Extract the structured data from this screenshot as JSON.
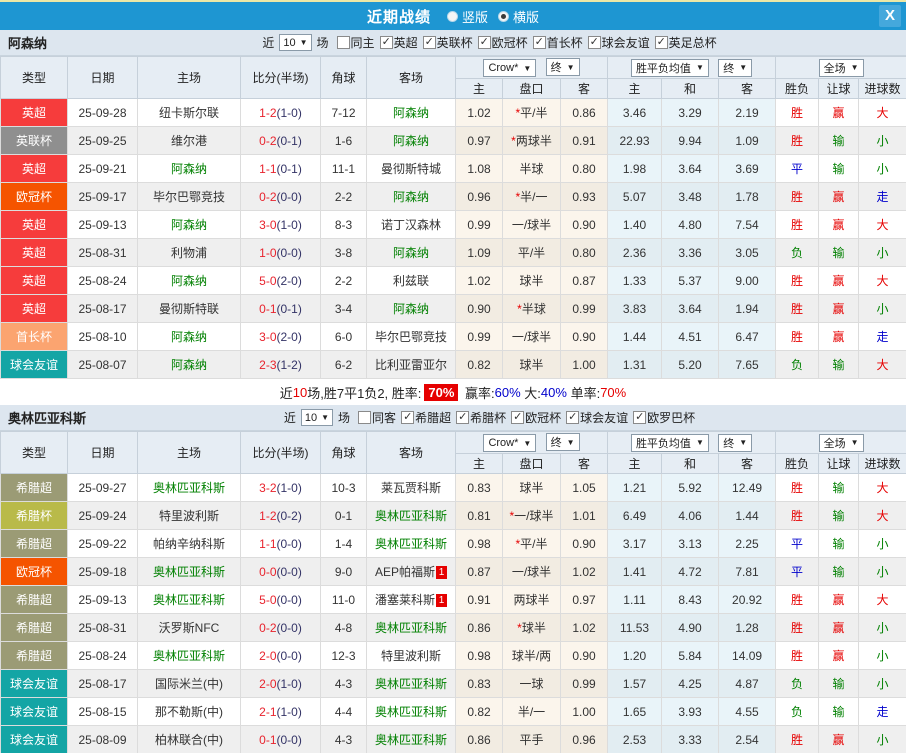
{
  "titlebar": {
    "title": "近期战绩",
    "vertical_label": "竖版",
    "horizontal_label": "横版",
    "selected_layout": "横版",
    "close_label": "X",
    "bar_color": "#1e96d2"
  },
  "table_header": {
    "type": "类型",
    "date": "日期",
    "home": "主场",
    "score": "比分(半场)",
    "corner": "角球",
    "away": "客场",
    "crow_select": "Crow*",
    "final_select": "终",
    "wdl_select": "胜平负均值",
    "final_select2": "终",
    "full_select": "全场",
    "sub_home": "主",
    "sub_handicap": "盘口",
    "sub_away": "客",
    "sub_whome": "主",
    "sub_draw": "和",
    "sub_waway": "客",
    "sub_result": "胜负",
    "sub_handicap_result": "让球",
    "sub_goals": "进球数"
  },
  "type_colors": {
    "英超": "#f63c3c",
    "英联杯": "#8f8f8f",
    "欧冠杯": "#f55400",
    "首长杯": "#fba470",
    "球会友谊": "#14a5a5",
    "希腊超": "#9b9b75",
    "希腊杯": "#b9ba49"
  },
  "value_colors": {
    "win": "#e60000",
    "draw": "#0000cc",
    "lose": "#008000",
    "self_team": "#008000",
    "score": "#e8232d",
    "half_score": "#333366"
  },
  "sections": [
    {
      "team": "阿森纳",
      "filters": {
        "near_label": "近",
        "count": "10",
        "unit_label": "场",
        "same_label": "同主",
        "same_checked": false,
        "leagues": [
          "英超",
          "英联杯",
          "欧冠杯",
          "首长杯",
          "球会友谊",
          "英足总杯"
        ]
      },
      "rows": [
        {
          "type": "英超",
          "date": "25-09-28",
          "home": "纽卡斯尔联",
          "score": "1-2",
          "half": "(1-0)",
          "corner": "7-12",
          "away": "阿森纳",
          "crow_home": "1.02",
          "handicap": "*平/半",
          "crow_away": "0.86",
          "odds_home": "3.46",
          "odds_draw": "3.29",
          "odds_away": "2.19",
          "result": "胜",
          "handicap_result": "赢",
          "goals": "大"
        },
        {
          "type": "英联杯",
          "date": "25-09-25",
          "home": "维尔港",
          "score": "0-2",
          "half": "(0-1)",
          "corner": "1-6",
          "away": "阿森纳",
          "crow_home": "0.97",
          "handicap": "*两球半",
          "crow_away": "0.91",
          "odds_home": "22.93",
          "odds_draw": "9.94",
          "odds_away": "1.09",
          "result": "胜",
          "handicap_result": "输",
          "goals": "小"
        },
        {
          "type": "英超",
          "date": "25-09-21",
          "home": "阿森纳",
          "score": "1-1",
          "half": "(0-1)",
          "corner": "11-1",
          "away": "曼彻斯特城",
          "crow_home": "1.08",
          "handicap": "半球",
          "crow_away": "0.80",
          "odds_home": "1.98",
          "odds_draw": "3.64",
          "odds_away": "3.69",
          "result": "平",
          "handicap_result": "输",
          "goals": "小"
        },
        {
          "type": "欧冠杯",
          "date": "25-09-17",
          "home": "毕尔巴鄂竞技",
          "score": "0-2",
          "half": "(0-0)",
          "corner": "2-2",
          "away": "阿森纳",
          "crow_home": "0.96",
          "handicap": "*半/一",
          "crow_away": "0.93",
          "odds_home": "5.07",
          "odds_draw": "3.48",
          "odds_away": "1.78",
          "result": "胜",
          "handicap_result": "赢",
          "goals": "走"
        },
        {
          "type": "英超",
          "date": "25-09-13",
          "home": "阿森纳",
          "score": "3-0",
          "half": "(1-0)",
          "corner": "8-3",
          "away": "诺丁汉森林",
          "crow_home": "0.99",
          "handicap": "一/球半",
          "crow_away": "0.90",
          "odds_home": "1.40",
          "odds_draw": "4.80",
          "odds_away": "7.54",
          "result": "胜",
          "handicap_result": "赢",
          "goals": "大"
        },
        {
          "type": "英超",
          "date": "25-08-31",
          "home": "利物浦",
          "score": "1-0",
          "half": "(0-0)",
          "corner": "3-8",
          "away": "阿森纳",
          "crow_home": "1.09",
          "handicap": "平/半",
          "crow_away": "0.80",
          "odds_home": "2.36",
          "odds_draw": "3.36",
          "odds_away": "3.05",
          "result": "负",
          "handicap_result": "输",
          "goals": "小"
        },
        {
          "type": "英超",
          "date": "25-08-24",
          "home": "阿森纳",
          "score": "5-0",
          "half": "(2-0)",
          "corner": "2-2",
          "away": "利兹联",
          "crow_home": "1.02",
          "handicap": "球半",
          "crow_away": "0.87",
          "odds_home": "1.33",
          "odds_draw": "5.37",
          "odds_away": "9.00",
          "result": "胜",
          "handicap_result": "赢",
          "goals": "大"
        },
        {
          "type": "英超",
          "date": "25-08-17",
          "home": "曼彻斯特联",
          "score": "0-1",
          "half": "(0-1)",
          "corner": "3-4",
          "away": "阿森纳",
          "crow_home": "0.90",
          "handicap": "*半球",
          "crow_away": "0.99",
          "odds_home": "3.83",
          "odds_draw": "3.64",
          "odds_away": "1.94",
          "result": "胜",
          "handicap_result": "赢",
          "goals": "小"
        },
        {
          "type": "首长杯",
          "date": "25-08-10",
          "home": "阿森纳",
          "score": "3-0",
          "half": "(2-0)",
          "corner": "6-0",
          "away": "毕尔巴鄂竞技",
          "crow_home": "0.99",
          "handicap": "一/球半",
          "crow_away": "0.90",
          "odds_home": "1.44",
          "odds_draw": "4.51",
          "odds_away": "6.47",
          "result": "胜",
          "handicap_result": "赢",
          "goals": "走"
        },
        {
          "type": "球会友谊",
          "date": "25-08-07",
          "home": "阿森纳",
          "score": "2-3",
          "half": "(1-2)",
          "corner": "6-2",
          "away": "比利亚雷亚尔",
          "crow_home": "0.82",
          "handicap": "球半",
          "crow_away": "1.00",
          "odds_home": "1.31",
          "odds_draw": "5.20",
          "odds_away": "7.65",
          "result": "负",
          "handicap_result": "输",
          "goals": "大"
        }
      ],
      "summary": {
        "parts": [
          {
            "text": "近",
            "color": "black"
          },
          {
            "text": "10",
            "color": "red"
          },
          {
            "text": "场,胜7平1负2, 胜率:",
            "color": "black"
          },
          {
            "text": "70%",
            "color": "white-on-red"
          },
          {
            "text": " 赢率:",
            "color": "black"
          },
          {
            "text": "60%",
            "color": "blue"
          },
          {
            "text": " 大:",
            "color": "black"
          },
          {
            "text": "40%",
            "color": "blue"
          },
          {
            "text": " 单率:",
            "color": "black"
          },
          {
            "text": "70%",
            "color": "red"
          }
        ]
      }
    },
    {
      "team": "奥林匹亚科斯",
      "filters": {
        "near_label": "近",
        "count": "10",
        "unit_label": "场",
        "same_label": "同客",
        "same_checked": false,
        "leagues": [
          "希腊超",
          "希腊杯",
          "欧冠杯",
          "球会友谊",
          "欧罗巴杯"
        ]
      },
      "rows": [
        {
          "type": "希腊超",
          "date": "25-09-27",
          "home": "奥林匹亚科斯",
          "score": "3-2",
          "half": "(1-0)",
          "corner": "10-3",
          "away": "莱瓦贾科斯",
          "crow_home": "0.83",
          "handicap": "球半",
          "crow_away": "1.05",
          "odds_home": "1.21",
          "odds_draw": "5.92",
          "odds_away": "12.49",
          "result": "胜",
          "handicap_result": "输",
          "goals": "大"
        },
        {
          "type": "希腊杯",
          "date": "25-09-24",
          "home": "特里波利斯",
          "score": "1-2",
          "half": "(0-2)",
          "corner": "0-1",
          "away": "奥林匹亚科斯",
          "crow_home": "0.81",
          "handicap": "*一/球半",
          "crow_away": "1.01",
          "odds_home": "6.49",
          "odds_draw": "4.06",
          "odds_away": "1.44",
          "result": "胜",
          "handicap_result": "输",
          "goals": "大"
        },
        {
          "type": "希腊超",
          "date": "25-09-22",
          "home": "帕纳辛纳科斯",
          "score": "1-1",
          "half": "(0-0)",
          "corner": "1-4",
          "away": "奥林匹亚科斯",
          "crow_home": "0.98",
          "handicap": "*平/半",
          "crow_away": "0.90",
          "odds_home": "3.17",
          "odds_draw": "3.13",
          "odds_away": "2.25",
          "result": "平",
          "handicap_result": "输",
          "goals": "小"
        },
        {
          "type": "欧冠杯",
          "date": "25-09-18",
          "home": "奥林匹亚科斯",
          "score": "0-0",
          "half": "(0-0)",
          "corner": "9-0",
          "away": "AEP帕福斯",
          "away_red": "1",
          "crow_home": "0.87",
          "handicap": "一/球半",
          "crow_away": "1.02",
          "odds_home": "1.41",
          "odds_draw": "4.72",
          "odds_away": "7.81",
          "result": "平",
          "handicap_result": "输",
          "goals": "小"
        },
        {
          "type": "希腊超",
          "date": "25-09-13",
          "home": "奥林匹亚科斯",
          "score": "5-0",
          "half": "(0-0)",
          "corner": "11-0",
          "away": "潘塞莱科斯",
          "away_red": "1",
          "crow_home": "0.91",
          "handicap": "两球半",
          "crow_away": "0.97",
          "odds_home": "1.11",
          "odds_draw": "8.43",
          "odds_away": "20.92",
          "result": "胜",
          "handicap_result": "赢",
          "goals": "大"
        },
        {
          "type": "希腊超",
          "date": "25-08-31",
          "home": "沃罗斯NFC",
          "score": "0-2",
          "half": "(0-0)",
          "corner": "4-8",
          "away": "奥林匹亚科斯",
          "crow_home": "0.86",
          "handicap": "*球半",
          "crow_away": "1.02",
          "odds_home": "11.53",
          "odds_draw": "4.90",
          "odds_away": "1.28",
          "result": "胜",
          "handicap_result": "赢",
          "goals": "小"
        },
        {
          "type": "希腊超",
          "date": "25-08-24",
          "home": "奥林匹亚科斯",
          "score": "2-0",
          "half": "(0-0)",
          "corner": "12-3",
          "away": "特里波利斯",
          "crow_home": "0.98",
          "handicap": "球半/两",
          "crow_away": "0.90",
          "odds_home": "1.20",
          "odds_draw": "5.84",
          "odds_away": "14.09",
          "result": "胜",
          "handicap_result": "赢",
          "goals": "小"
        },
        {
          "type": "球会友谊",
          "date": "25-08-17",
          "home": "国际米兰(中)",
          "score": "2-0",
          "half": "(1-0)",
          "corner": "4-3",
          "away": "奥林匹亚科斯",
          "crow_home": "0.83",
          "handicap": "一球",
          "crow_away": "0.99",
          "odds_home": "1.57",
          "odds_draw": "4.25",
          "odds_away": "4.87",
          "result": "负",
          "handicap_result": "输",
          "goals": "小"
        },
        {
          "type": "球会友谊",
          "date": "25-08-15",
          "home": "那不勒斯(中)",
          "score": "2-1",
          "half": "(1-0)",
          "corner": "4-4",
          "away": "奥林匹亚科斯",
          "crow_home": "0.82",
          "handicap": "半/一",
          "crow_away": "1.00",
          "odds_home": "1.65",
          "odds_draw": "3.93",
          "odds_away": "4.55",
          "result": "负",
          "handicap_result": "输",
          "goals": "走"
        },
        {
          "type": "球会友谊",
          "date": "25-08-09",
          "home": "柏林联合(中)",
          "score": "0-1",
          "half": "(0-0)",
          "corner": "4-3",
          "away": "奥林匹亚科斯",
          "crow_home": "0.86",
          "handicap": "平手",
          "crow_away": "0.96",
          "odds_home": "2.53",
          "odds_draw": "3.33",
          "odds_away": "2.54",
          "result": "胜",
          "handicap_result": "赢",
          "goals": "小"
        }
      ],
      "summary": null
    }
  ]
}
